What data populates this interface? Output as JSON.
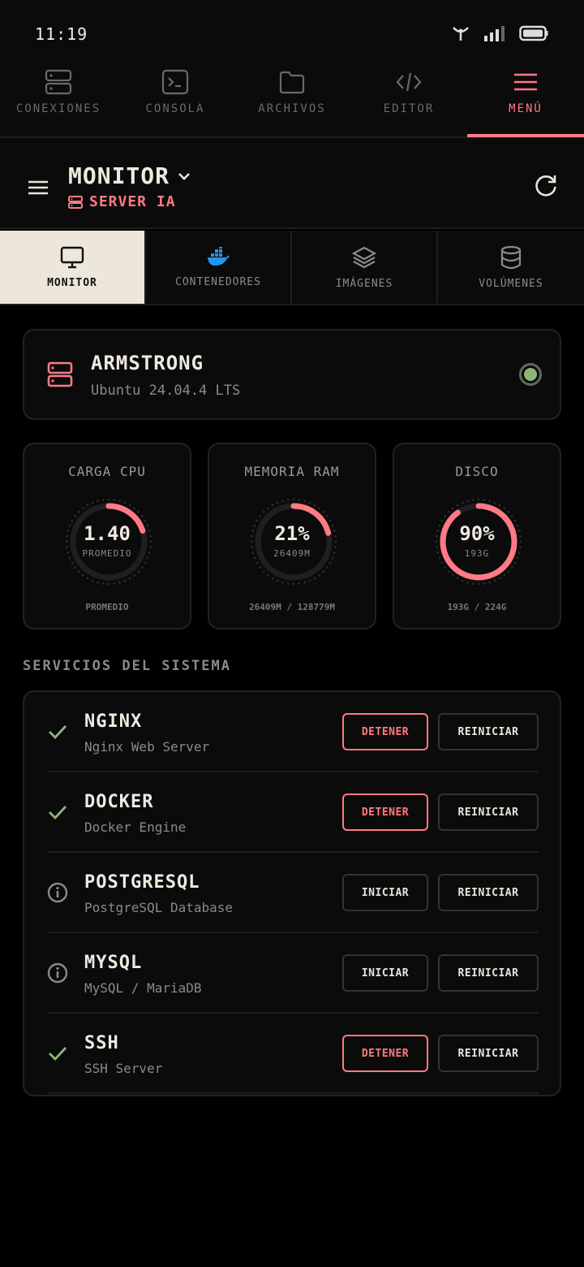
{
  "status_bar": {
    "time": "11:19"
  },
  "top_nav": [
    {
      "label": "CONEXIONES",
      "icon": "server-icon",
      "active": false
    },
    {
      "label": "CONSOLA",
      "icon": "terminal-icon",
      "active": false
    },
    {
      "label": "ARCHIVOS",
      "icon": "folder-icon",
      "active": false
    },
    {
      "label": "EDITOR",
      "icon": "code-icon",
      "active": false
    },
    {
      "label": "MENÚ",
      "icon": "menu-icon",
      "active": true
    }
  ],
  "header": {
    "title": "MONITOR",
    "subtitle": "SERVER IA"
  },
  "tabs": [
    {
      "label": "MONITOR",
      "icon": "monitor-icon",
      "active": true
    },
    {
      "label": "CONTENEDORES",
      "icon": "docker-icon",
      "active": false
    },
    {
      "label": "IMÁGENES",
      "icon": "layers-icon",
      "active": false
    },
    {
      "label": "VOLÚMENES",
      "icon": "database-icon",
      "active": false
    }
  ],
  "server": {
    "name": "ARMSTRONG",
    "os": "Ubuntu 24.04.4 LTS",
    "status": "online"
  },
  "metrics": [
    {
      "title": "CARGA CPU",
      "value": "1.40",
      "sub": "PROMEDIO",
      "footer": "PROMEDIO",
      "fraction": 0.2
    },
    {
      "title": "MEMORIA RAM",
      "value": "21%",
      "sub": "26409M",
      "footer": "26409M / 128779M",
      "fraction": 0.21
    },
    {
      "title": "DISCO",
      "value": "90%",
      "sub": "193G",
      "footer": "193G / 224G",
      "fraction": 0.9
    }
  ],
  "section_title": "SERVICIOS DEL SISTEMA",
  "services": [
    {
      "name": "NGINX",
      "desc": "Nginx Web Server",
      "running": true,
      "action": "DETENER",
      "restart": "REINICIAR"
    },
    {
      "name": "DOCKER",
      "desc": "Docker Engine",
      "running": true,
      "action": "DETENER",
      "restart": "REINICIAR"
    },
    {
      "name": "POSTGRESQL",
      "desc": "PostgreSQL Database",
      "running": false,
      "action": "INICIAR",
      "restart": "REINICIAR"
    },
    {
      "name": "MYSQL",
      "desc": "MySQL / MariaDB",
      "running": false,
      "action": "INICIAR",
      "restart": "REINICIAR"
    },
    {
      "name": "SSH",
      "desc": "SSH Server",
      "running": true,
      "action": "DETENER",
      "restart": "REINICIAR"
    }
  ],
  "colors": {
    "accent": "#ff7a85",
    "ok": "#8fb47a",
    "active_tab": "#ede6da"
  }
}
